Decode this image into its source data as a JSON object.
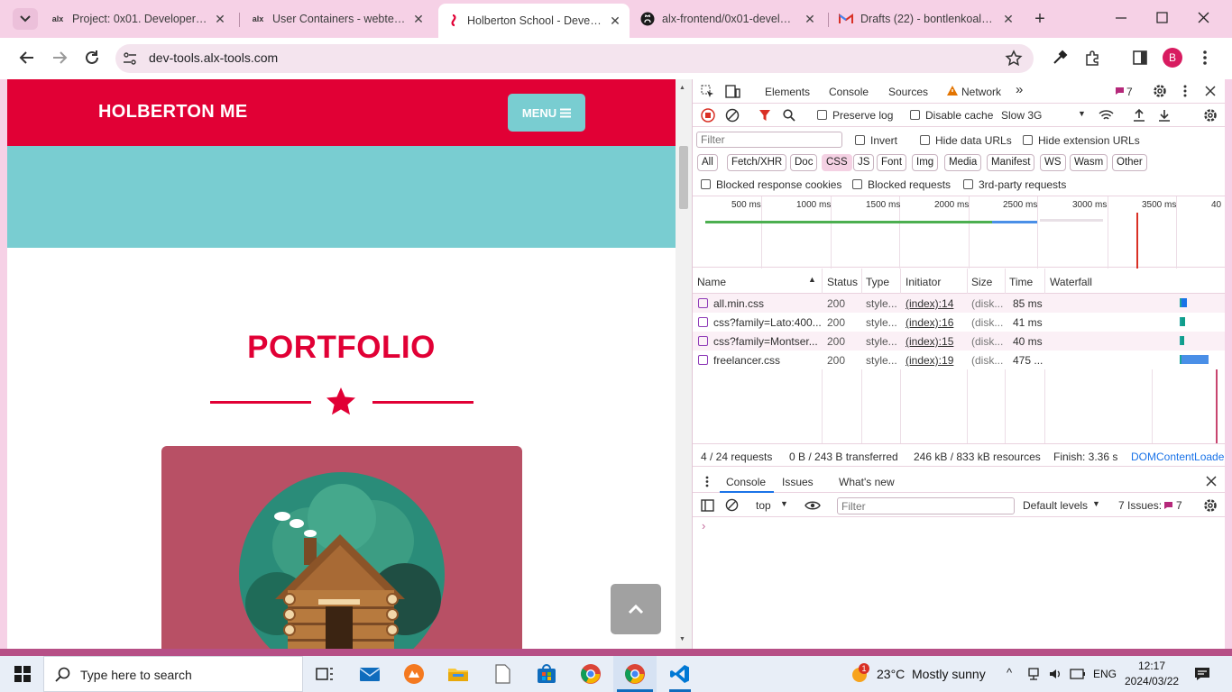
{
  "tabs": [
    {
      "favicon": "alx",
      "title": "Project: 0x01. Developer to"
    },
    {
      "favicon": "alx",
      "title": "User Containers - webterm"
    },
    {
      "favicon": "holberton-icon",
      "title": "Holberton School - Develop"
    },
    {
      "favicon": "github-icon",
      "title": "alx-frontend/0x01-develope"
    },
    {
      "favicon": "gmail-icon",
      "title": "Drafts (22) - bontlenkoale21"
    }
  ],
  "address": {
    "url": "dev-tools.alx-tools.com"
  },
  "profile": {
    "initial": "B"
  },
  "site": {
    "brand": "HOLBERTON ME",
    "menu_label": "MENU",
    "portfolio_title": "PORTFOLIO",
    "colors": {
      "primary": "#e10035",
      "teal": "#79cdd1",
      "card": "#b85065"
    }
  },
  "devtools": {
    "tabs": [
      "Elements",
      "Console",
      "Sources",
      "Network"
    ],
    "active_tab": "Network",
    "issues_count": "7",
    "toolbar": {
      "preserve_log": "Preserve log",
      "disable_cache": "Disable cache",
      "throttle": "Slow 3G"
    },
    "filter": {
      "placeholder": "Filter",
      "invert": "Invert",
      "hide_data_urls": "Hide data URLs",
      "hide_extension_urls": "Hide extension URLs",
      "types": [
        "All",
        "Fetch/XHR",
        "Doc",
        "CSS",
        "JS",
        "Font",
        "Img",
        "Media",
        "Manifest",
        "WS",
        "Wasm",
        "Other"
      ],
      "active_type": "CSS",
      "blocked_cookies": "Blocked response cookies",
      "blocked_requests": "Blocked requests",
      "third_party": "3rd-party requests"
    },
    "timeline_ticks": [
      "500 ms",
      "1000 ms",
      "1500 ms",
      "2000 ms",
      "2500 ms",
      "3000 ms",
      "3500 ms",
      "40"
    ],
    "columns": [
      "Name",
      "Status",
      "Type",
      "Initiator",
      "Size",
      "Time",
      "Waterfall"
    ],
    "requests": [
      {
        "name": "all.min.css",
        "status": "200",
        "type": "style...",
        "initiator": "(index):14",
        "size": "(disk...",
        "time": "85 ms"
      },
      {
        "name": "css?family=Lato:400...",
        "status": "200",
        "type": "style...",
        "initiator": "(index):16",
        "size": "(disk...",
        "time": "41 ms"
      },
      {
        "name": "css?family=Montser...",
        "status": "200",
        "type": "style...",
        "initiator": "(index):15",
        "size": "(disk...",
        "time": "40 ms"
      },
      {
        "name": "freelancer.css",
        "status": "200",
        "type": "style...",
        "initiator": "(index):19",
        "size": "(disk...",
        "time": "475 ..."
      }
    ],
    "summary": {
      "requests": "4 / 24 requests",
      "transferred": "0 B / 243 B transferred",
      "resources": "246 kB / 833 kB resources",
      "finish": "Finish: 3.36 s",
      "dcl": "DOMContentLoade"
    },
    "drawer": {
      "tabs": [
        "Console",
        "Issues",
        "What's new"
      ],
      "context": "top",
      "filter_placeholder": "Filter",
      "levels": "Default levels",
      "issues": "7 Issues:",
      "issues_count": "7"
    }
  },
  "taskbar": {
    "search_placeholder": "Type here to search",
    "weather_temp": "23°C",
    "weather_desc": "Mostly sunny",
    "language": "ENG",
    "time": "12:17",
    "date": "2024/03/22",
    "weather_badge": "1"
  }
}
